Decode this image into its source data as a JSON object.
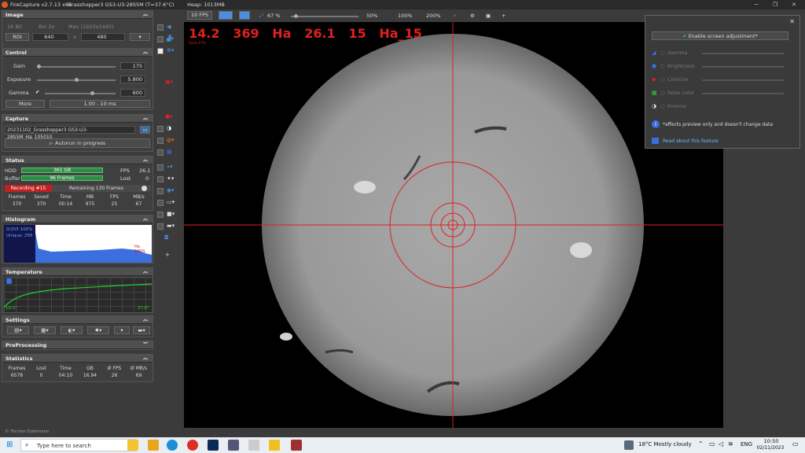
{
  "title": {
    "app": "FireCapture v2.7.13 x64",
    "camera": "Grasshopper3 GS3-U3-28S5M (T=37.6°C)",
    "heap": "Heap: 1013MB"
  },
  "image_panel": {
    "header": "Image",
    "bit": "16 Bit",
    "bin": "Bin 2x",
    "max": "Max (1920x1440)",
    "roi": "ROI",
    "w": "640",
    "x": "x",
    "h": "480"
  },
  "control_panel": {
    "header": "Control",
    "gain_label": "Gain",
    "gain_value": "175",
    "exposure_label": "Exposure",
    "exposure_value": "5.800",
    "gamma_label": "Gamma",
    "gamma_value": "600",
    "more_label": "More",
    "range": "1.00 - 10 ms",
    "gain_pct": 0.05,
    "exposure_pct": 0.5,
    "gamma_pct": 0.65
  },
  "capture_panel": {
    "header": "Capture",
    "filename": "20231102_Grasshopper3 GS3-U3-28S5M_Ha_105010",
    "autorun": "Autorun in progress"
  },
  "status_panel": {
    "header": "Status",
    "hdd_label": "HDD",
    "hdd_value": "361 GB",
    "fps_label": "FPS",
    "fps_value": "26.1",
    "buffer_label": "Buffer",
    "buffer_value": "96 Frames",
    "lost_label": "Lost",
    "lost_value": "0",
    "recording": "Recording #15",
    "remaining": "Remaining 130 Frames",
    "cols": [
      "Frames",
      "Saved",
      "Time",
      "MB",
      "FPS",
      "MB/s"
    ],
    "vals": [
      "370",
      "370",
      "00:14",
      "975",
      "25",
      "67"
    ]
  },
  "histogram_panel": {
    "header": "Histogram",
    "line1": "0/255 100%",
    "line2": "Unique: 256",
    "right": "Ha 100%"
  },
  "temperature_panel": {
    "header": "Temperature",
    "low": "19.5°",
    "high": "37.6°"
  },
  "settings_panel": {
    "header": "Settings"
  },
  "preprocessing_panel": {
    "header": "PreProcessing"
  },
  "statistics_panel": {
    "header": "Statistics",
    "cols": [
      "Frames",
      "Lost",
      "Time",
      "GB",
      "Ø FPS",
      "Ø MB/s"
    ],
    "vals": [
      "6578",
      "0",
      "04:10",
      "16.94",
      "26",
      "69"
    ]
  },
  "copyright": "© Torsten Edelmann",
  "toolbar": {
    "fps": "10 FPS",
    "zoom": "67 %",
    "z50": "50%",
    "z100": "100%",
    "z200": "200%"
  },
  "overlay_text": {
    "big": "14.2   369   Ha   26.1   15   Ha_15",
    "small": "Zoom 67%"
  },
  "screen_adjust": {
    "button": "Enable screen adjustment*",
    "items": [
      "Gamma",
      "Brightness",
      "Colorize",
      "False color",
      "Inverse"
    ],
    "note": "*affects preview only and doesn't change data",
    "link": "Read about this feature"
  },
  "taskbar": {
    "search": "Type here to search",
    "weather": "18°C  Mostly cloudy",
    "lang": "ENG",
    "time": "10:50",
    "date": "02/11/2023"
  },
  "colors": {
    "accent_red": "#e02020",
    "green": "#2e8b47",
    "link": "#6fb4ff"
  }
}
